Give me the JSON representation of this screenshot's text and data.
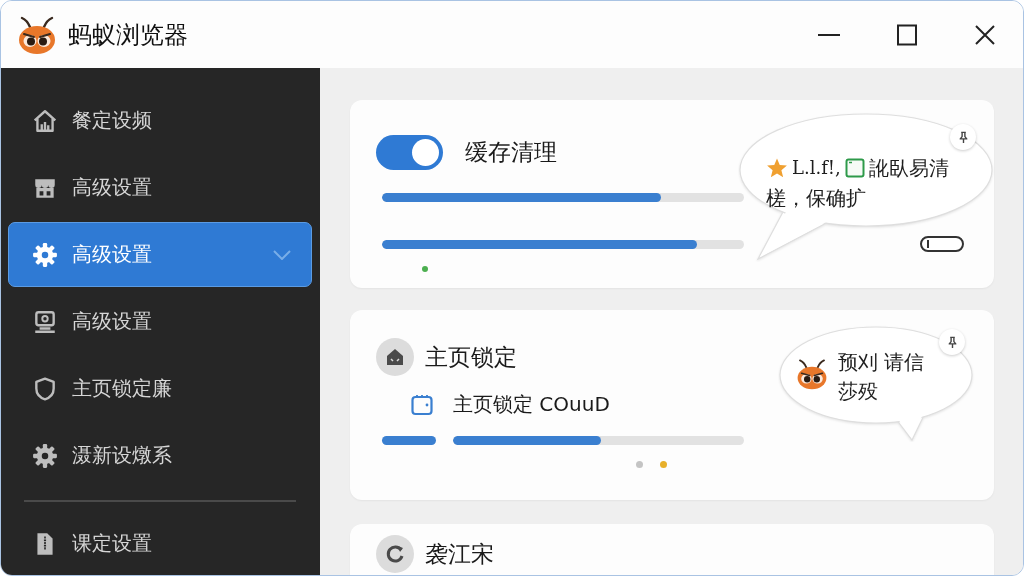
{
  "window": {
    "title": "蚂蚁浏览器"
  },
  "sidebar": {
    "items": [
      {
        "label": "餐定设频",
        "selected": false
      },
      {
        "label": "高级设置",
        "selected": false
      },
      {
        "label": "高级设置",
        "selected": true
      },
      {
        "label": "高级设置",
        "selected": false
      },
      {
        "label": "主页锁定廉",
        "selected": false
      },
      {
        "label": "滠新设燉系",
        "selected": false
      }
    ],
    "bottom_items": [
      {
        "label": "课定设置",
        "selected": false
      }
    ]
  },
  "cards": [
    {
      "kind": "toggle",
      "toggle": {
        "on": true
      },
      "title": "缓存清理",
      "progress": [
        {
          "level": 0.77
        },
        {
          "level": 0.87
        }
      ],
      "secondary_toggle": {
        "on": false
      },
      "bubble": {
        "kind": "note",
        "texts": [
          "L.l.f!,",
          "訛臥易清",
          "槎，保确扩"
        ]
      }
    },
    {
      "kind": "detail",
      "title": "主页锁定",
      "subtitle": "主页锁定 COuuD",
      "progress": [
        {
          "level": 0.51
        }
      ],
      "pager": [
        {
          "selected": false
        },
        {
          "selected": true
        }
      ],
      "bubble": {
        "kind": "mascot",
        "texts": [
          "预刈 请信",
          "莎殁"
        ]
      }
    },
    {
      "kind": "info",
      "title": "袭江宋"
    }
  ]
}
